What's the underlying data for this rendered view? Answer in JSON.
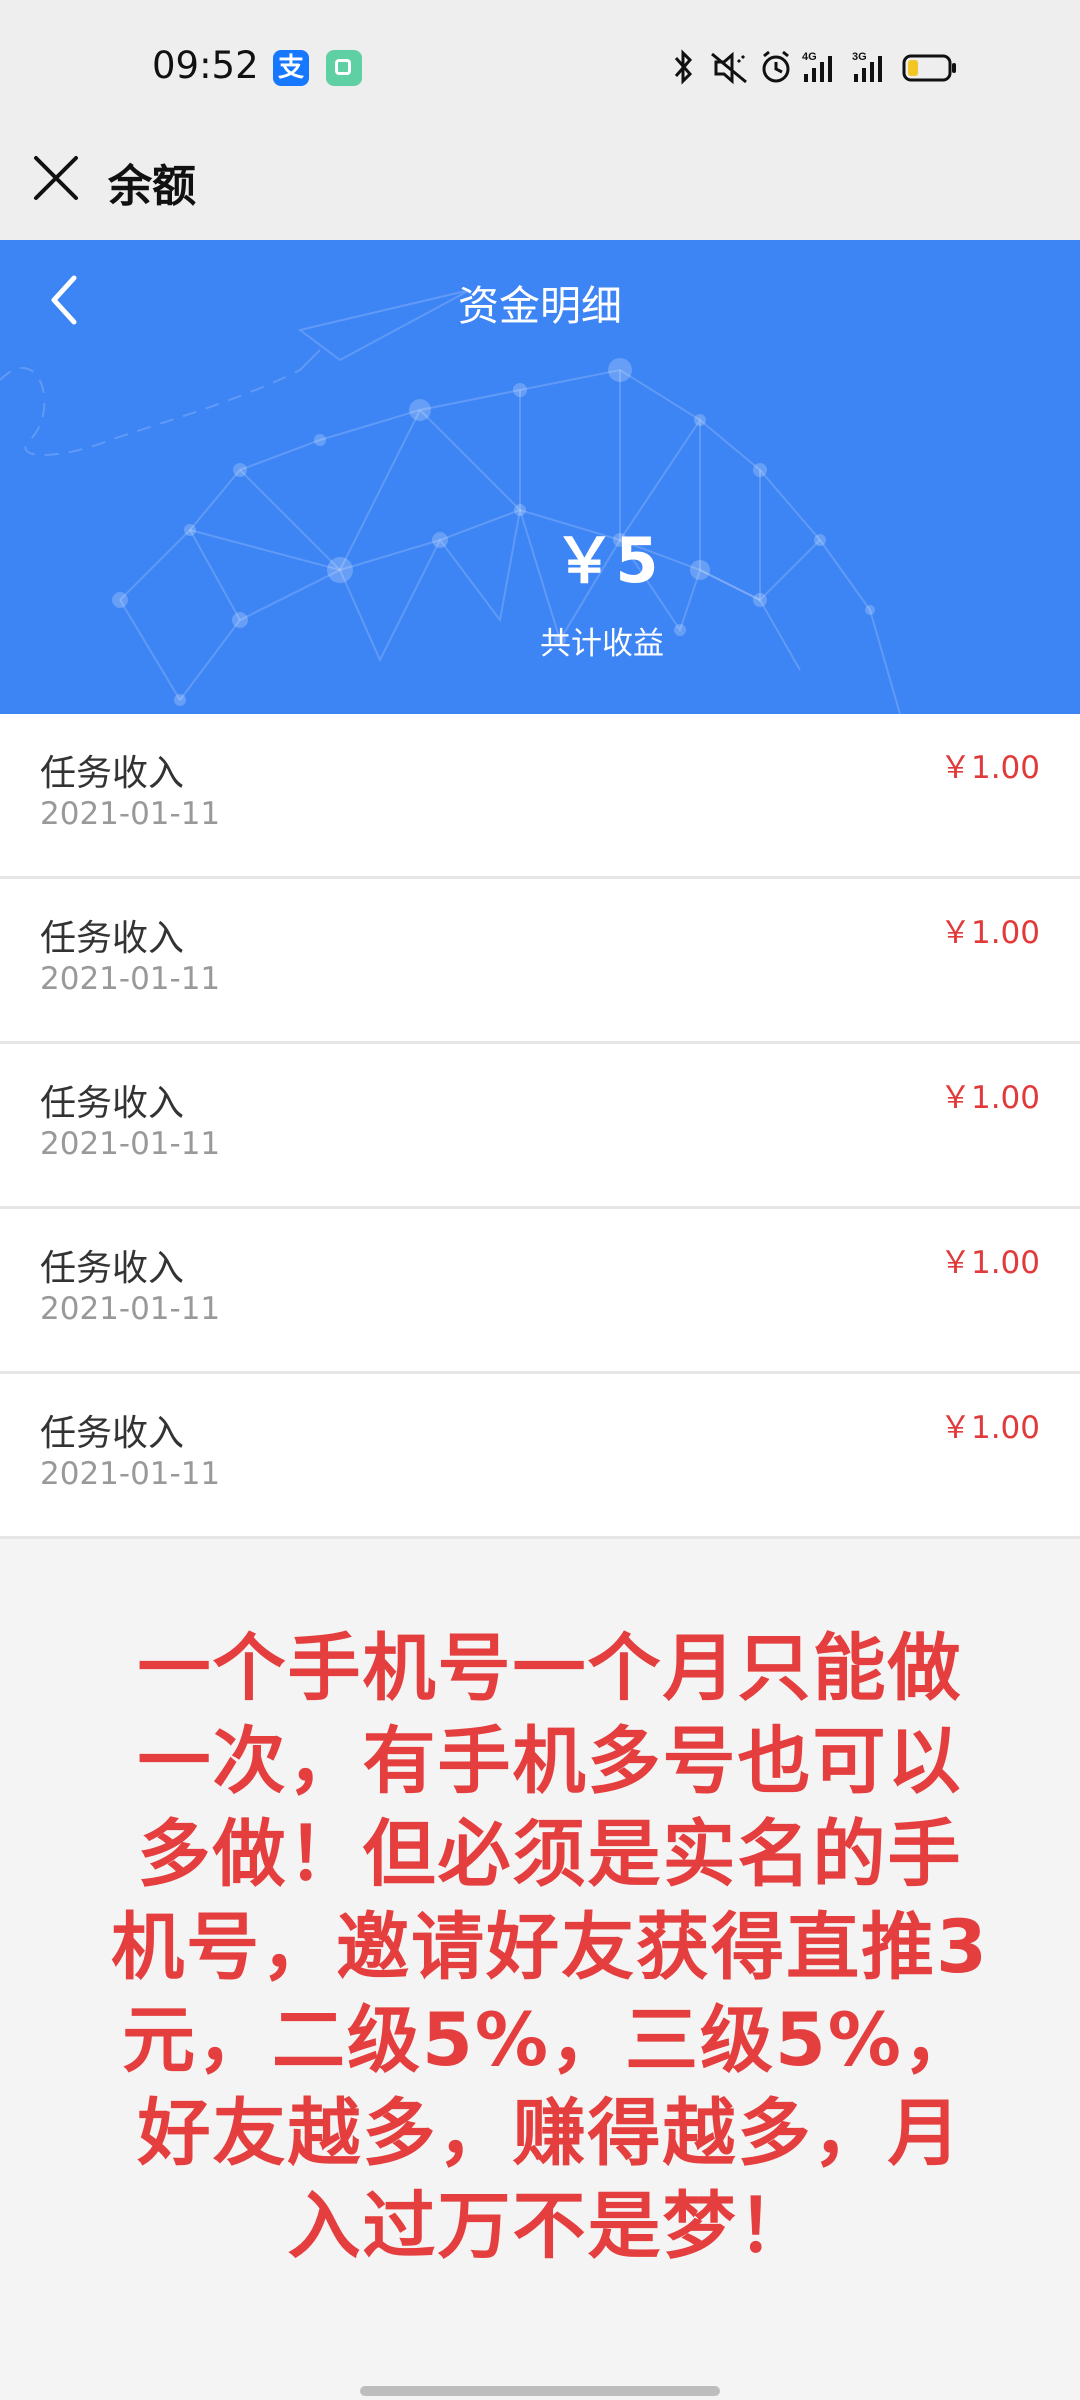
{
  "status_bar": {
    "time": "09:52",
    "alipay_icon_glyph": "支",
    "icons": [
      "alipay-icon",
      "app-icon",
      "bluetooth-icon",
      "mute-icon",
      "alarm-icon",
      "signal-4g-icon",
      "signal-3g-icon",
      "battery-icon"
    ]
  },
  "header": {
    "title": "余额",
    "close_icon": "close-icon"
  },
  "banner": {
    "title": "资金明细",
    "amount": "￥5",
    "amount_label": "共计收益",
    "back_icon": "chevron-left-icon",
    "background_color": "#3d84f4"
  },
  "records": [
    {
      "title": "任务收入",
      "date": "2021-01-11",
      "amount": "￥1.00"
    },
    {
      "title": "任务收入",
      "date": "2021-01-11",
      "amount": "￥1.00"
    },
    {
      "title": "任务收入",
      "date": "2021-01-11",
      "amount": "￥1.00"
    },
    {
      "title": "任务收入",
      "date": "2021-01-11",
      "amount": "￥1.00"
    },
    {
      "title": "任务收入",
      "date": "2021-01-11",
      "amount": "￥1.00"
    }
  ],
  "promo": {
    "text": "一个手机号一个月只能做一次，有手机多号也可以多做！但必须是实名的手机号，邀请好友获得直推3元，二级5%，三级5%，好友越多，赚得越多，月入过万不是梦！",
    "color": "#e53e3e"
  },
  "colors": {
    "amount_red": "#e03a3a",
    "date_gray": "#999999"
  }
}
